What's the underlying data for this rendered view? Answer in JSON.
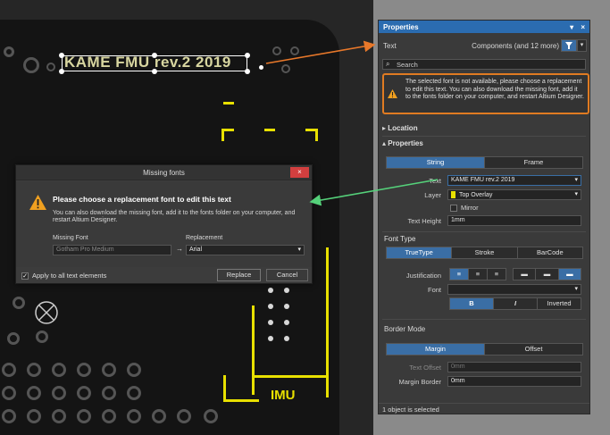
{
  "pcb": {
    "selected_text": "KAME FMU rev.2 2019",
    "imu_label": "IMU"
  },
  "properties": {
    "title": "Properties",
    "ctl_pin": "▾",
    "ctl_close": "×",
    "object_type": "Text",
    "filter_label": "Components (and 12 more)",
    "search_placeholder": "Search",
    "warning": "The selected font is not available, please choose a replacement  to edit this text. You can also download the missing font, add it to the fonts folder on your computer, and restart Altium Designer.",
    "location_header": "Location",
    "properties_header": "Properties",
    "text_tabs": [
      "String",
      "Frame"
    ],
    "text_label": "Text",
    "text_value": "KAME FMU rev.2 2019",
    "layer_label": "Layer",
    "layer_value": "Top Overlay",
    "layer_color": "#e8e000",
    "mirror_label": "Mirror",
    "text_height_label": "Text Height",
    "text_height_value": "1mm",
    "font_type_header": "Font Type",
    "font_type_tabs": [
      "TrueType",
      "Stroke",
      "BarCode"
    ],
    "justification_label": "Justification",
    "font_label": "Font",
    "font_value": "",
    "style_buttons": [
      "B",
      "I",
      "Inverted"
    ],
    "border_mode_header": "Border Mode",
    "border_tabs": [
      "Margin",
      "Offset"
    ],
    "text_offset_label": "Text Offset",
    "text_offset_value": "0mm",
    "margin_border_label": "Margin Border",
    "margin_border_value": "0mm",
    "status": "1 object is selected"
  },
  "dialog": {
    "title": "Missing fonts",
    "close_label": "×",
    "heading": "Please choose a replacement font to edit this text",
    "body": "You can also download the missing font, add it to the fonts folder on your computer, and restart Altium Designer.",
    "missing_font_label": "Missing Font",
    "missing_font_value": "Gotham Pro Medium",
    "replacement_label": "Replacement",
    "replacement_value": "Arial",
    "arrow": "→",
    "apply_all_label": "Apply to all text elements",
    "apply_all_checked": true,
    "replace_button": "Replace",
    "cancel_button": "Cancel"
  },
  "colors": {
    "accent": "#2b6cb0",
    "warning_border": "#e07b22",
    "warning_icon": "#f0a020",
    "arrow_orange": "#e8782a",
    "arrow_green": "#55d17a",
    "silkscreen": "#e8e000"
  }
}
